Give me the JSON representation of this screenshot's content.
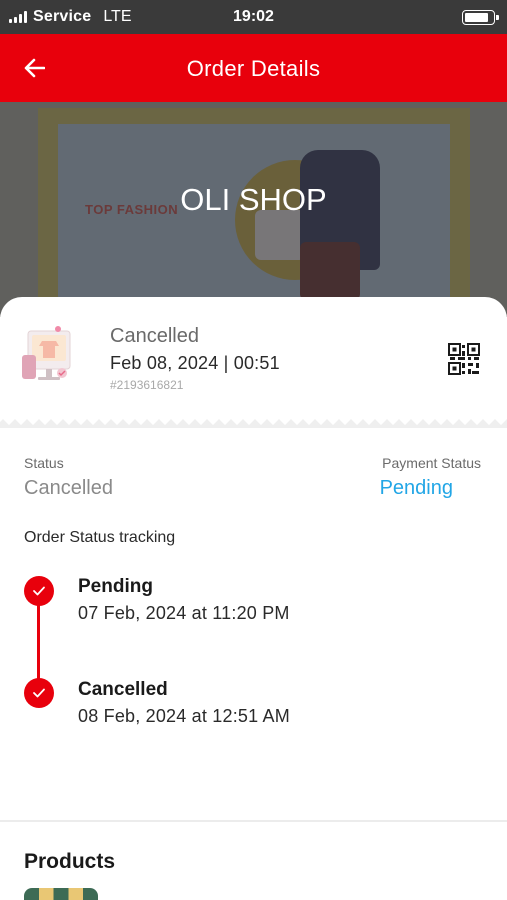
{
  "status_bar": {
    "carrier": "Service",
    "network": "LTE",
    "time": "19:02",
    "battery_level": 0.9
  },
  "app_bar": {
    "title": "Order Details",
    "back_icon": "arrow-left-icon"
  },
  "banner": {
    "shop_name": "OLI SHOP",
    "promo_text": "TOP FASHION"
  },
  "order": {
    "status": "Cancelled",
    "datetime": "Feb 08, 2024 | 00:51",
    "order_id": "#2193616821",
    "qr_icon": "qr-code-icon"
  },
  "status_section": {
    "status_label": "Status",
    "status_value": "Cancelled",
    "payment_label": "Payment Status",
    "payment_value": "Pending",
    "tracking_title": "Order Status tracking",
    "timeline": [
      {
        "title": "Pending",
        "time": "07 Feb, 2024 at 11:20 PM"
      },
      {
        "title": "Cancelled",
        "time": "08 Feb, 2024 at 12:51 AM"
      }
    ]
  },
  "products": {
    "title": "Products"
  },
  "colors": {
    "primary": "#e8000c",
    "link_blue": "#22a6e6",
    "status_bar": "#3a3a3a"
  }
}
